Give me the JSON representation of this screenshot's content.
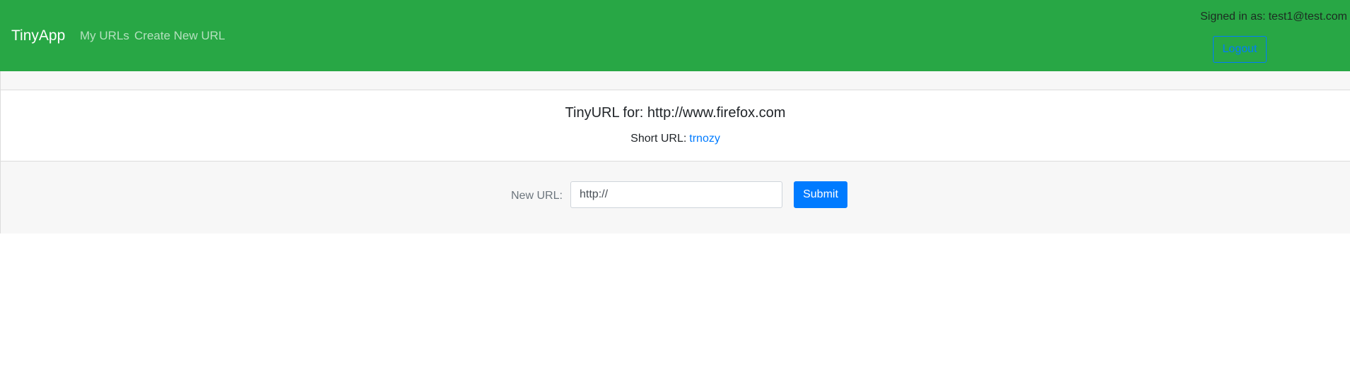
{
  "navbar": {
    "brand": "TinyApp",
    "links": [
      {
        "label": "My URLs"
      },
      {
        "label": "Create New URL"
      }
    ],
    "signed_in_label": "Signed in as:",
    "user_email": "test1@test.com",
    "logout_label": "Logout"
  },
  "card": {
    "title": "TinyURL for: http://www.firefox.com",
    "short_url_label": "Short URL:",
    "short_url_value": "trnozy"
  },
  "update_form": {
    "label": "New URL:",
    "input_value": "http://",
    "submit_label": "Submit"
  },
  "colors": {
    "navbar_bg": "#28a745",
    "primary": "#007bff",
    "panel_bg": "#f7f7f7"
  }
}
